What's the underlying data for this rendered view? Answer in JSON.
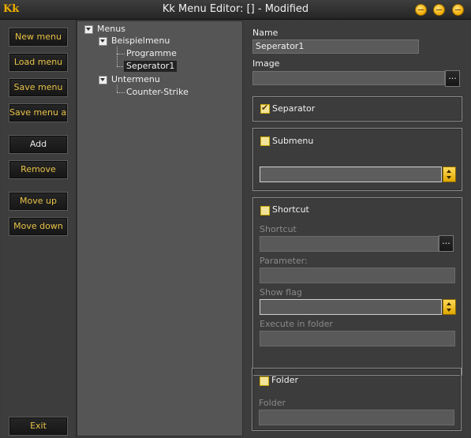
{
  "window": {
    "logo_text": "Kk",
    "title": "Kk Menu Editor: [] - Modified"
  },
  "sidebar": {
    "new_menu": "New menu",
    "load_menu": "Load menu",
    "save_menu": "Save menu",
    "save_menu_as": "Save menu as",
    "add": "Add",
    "remove": "Remove",
    "move_up": "Move up",
    "move_down": "Move down",
    "exit": "Exit"
  },
  "tree": {
    "root": "Menus",
    "n1": "Beispielmenu",
    "n1a": "Programme",
    "n1b": "Seperator1",
    "n2": "Untermenu",
    "n2a": "Counter-Strike"
  },
  "props": {
    "name_label": "Name",
    "name_value": "Seperator1",
    "image_label": "Image",
    "image_value": "",
    "browse": "...",
    "separator_label": "Separator",
    "separator_checked": true,
    "submenu_label": "Submenu",
    "submenu_checked": false,
    "shortcut_check_label": "Shortcut",
    "shortcut_checked": false,
    "shortcut_label": "Shortcut",
    "parameter_label": "Parameter:",
    "showflag_label": "Show flag",
    "exec_label": "Execute in folder",
    "folder_check_label": "Folder",
    "folder_checked": false,
    "folder_label": "Folder"
  },
  "colors": {
    "accent": "#e8c347",
    "background": "#3c3c3c",
    "tree_bg": "#555555"
  }
}
